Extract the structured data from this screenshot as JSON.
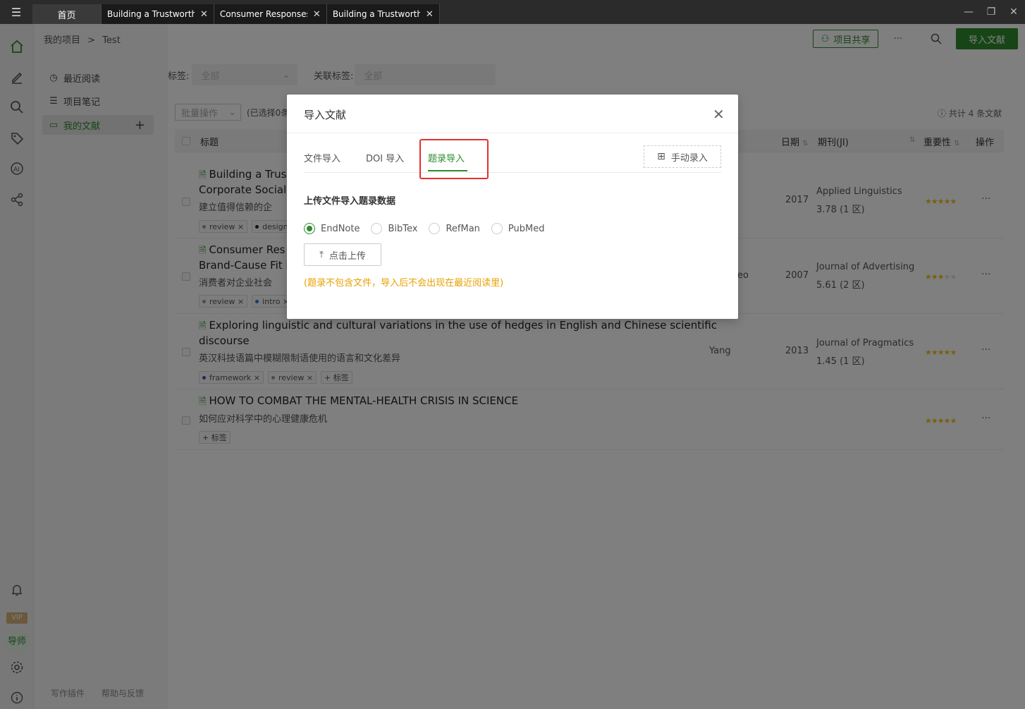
{
  "titlebar": {
    "tabs": [
      {
        "label": "首页"
      },
      {
        "label": "Building a Trustworth..."
      },
      {
        "label": "Consumer Responses..."
      },
      {
        "label": "Building a Trustworth..."
      }
    ]
  },
  "breadcrumb": {
    "root": "我的项目",
    "separator": ">",
    "current": "Test"
  },
  "toolbar": {
    "share_label": "项目共享",
    "more": "···",
    "import_label": "导入文献"
  },
  "sidebar": {
    "items": [
      {
        "label": "最近阅读"
      },
      {
        "label": "项目笔记"
      },
      {
        "label": "我的文献"
      }
    ],
    "add": "+",
    "bottom": [
      "写作插件",
      "帮助与反馈"
    ]
  },
  "leftbar": {
    "vip": "VIP",
    "tutor": "导师"
  },
  "filters": {
    "tag_label": "标签:",
    "tag_value": "全部",
    "related_label": "关联标签:",
    "related_value": "全部",
    "batch_label": "批量操作",
    "selected_prefix": "(已选择0条",
    "total": "共计 4 条文献"
  },
  "table": {
    "headers": {
      "title": "标题",
      "date": "日期",
      "journal": "期刊(JI)",
      "importance": "重要性",
      "actions": "操作"
    },
    "rows": [
      {
        "title_line1": "Building a Trus",
        "title_line2": "Corporate Social",
        "translation": "建立值得信赖的企",
        "tags": [
          "review ×",
          "design"
        ],
        "author": "",
        "year": "2017",
        "journal": "Applied Linguistics",
        "impact": "3.78 (1 区)",
        "stars": 5
      },
      {
        "title_line1": "Consumer Res",
        "title_line2": "Brand-Cause Fit i",
        "translation": "消费者对企业社会",
        "tags": [
          "review ×",
          "intro ×"
        ],
        "author": "eo",
        "year": "2007",
        "journal": "Journal of Advertising",
        "impact": "5.61 (2 区)",
        "stars": 3
      },
      {
        "title_line1": "Exploring linguistic and cultural variations in the use of hedges in English and Chinese scientific",
        "title_line2": "discourse",
        "translation": "英汉科技语篇中模糊限制语使用的语言和文化差异",
        "tags": [
          "framework ×",
          "review ×",
          "+ 标签"
        ],
        "author": "Yang",
        "year": "2013",
        "journal": "Journal of Pragmatics",
        "impact": "1.45 (1 区)",
        "stars": 5
      },
      {
        "title_line1": "HOW TO COMBAT THE MENTAL-HEALTH CRISIS IN SCIENCE",
        "title_line2": "",
        "translation": "如何应对科学中的心理健康危机",
        "tags": [
          "+ 标签"
        ],
        "author": "",
        "year": "",
        "journal": "",
        "impact": "",
        "stars": 5
      }
    ]
  },
  "modal": {
    "title": "导入文献",
    "tabs": [
      "文件导入",
      "DOI 导入",
      "题录导入"
    ],
    "manual_label": "手动录入",
    "section_title": "上传文件导入题录数据",
    "formats": [
      "EndNote",
      "BibTex",
      "RefMan",
      "PubMed"
    ],
    "selected_format": "EndNote",
    "upload_label": "点击上传",
    "warning": "(题录不包含文件，导入后不会出现在最近阅读里)"
  },
  "colors": {
    "accent": "#2e8b2e",
    "highlight": "#e0312d",
    "warning": "#e8a000"
  }
}
